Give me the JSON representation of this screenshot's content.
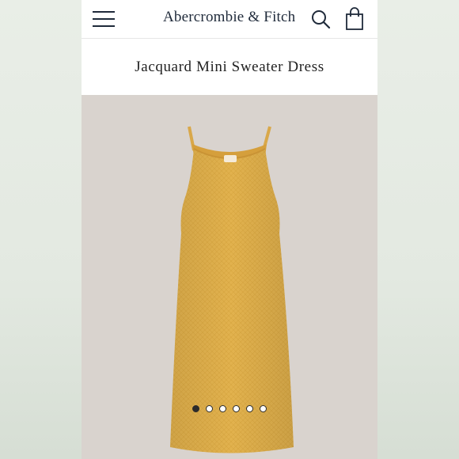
{
  "header": {
    "brand": "Abercrombie & Fitch",
    "menu_icon": "hamburger-menu-icon",
    "search_icon": "search-icon",
    "bag_icon": "shopping-bag-icon"
  },
  "product": {
    "title": "Jacquard Mini Sweater Dress",
    "color": "#e2b24e"
  },
  "carousel": {
    "total": 6,
    "active_index": 0
  },
  "colors": {
    "brand_text": "#1f2a3a",
    "image_background": "#d9d3ce"
  }
}
